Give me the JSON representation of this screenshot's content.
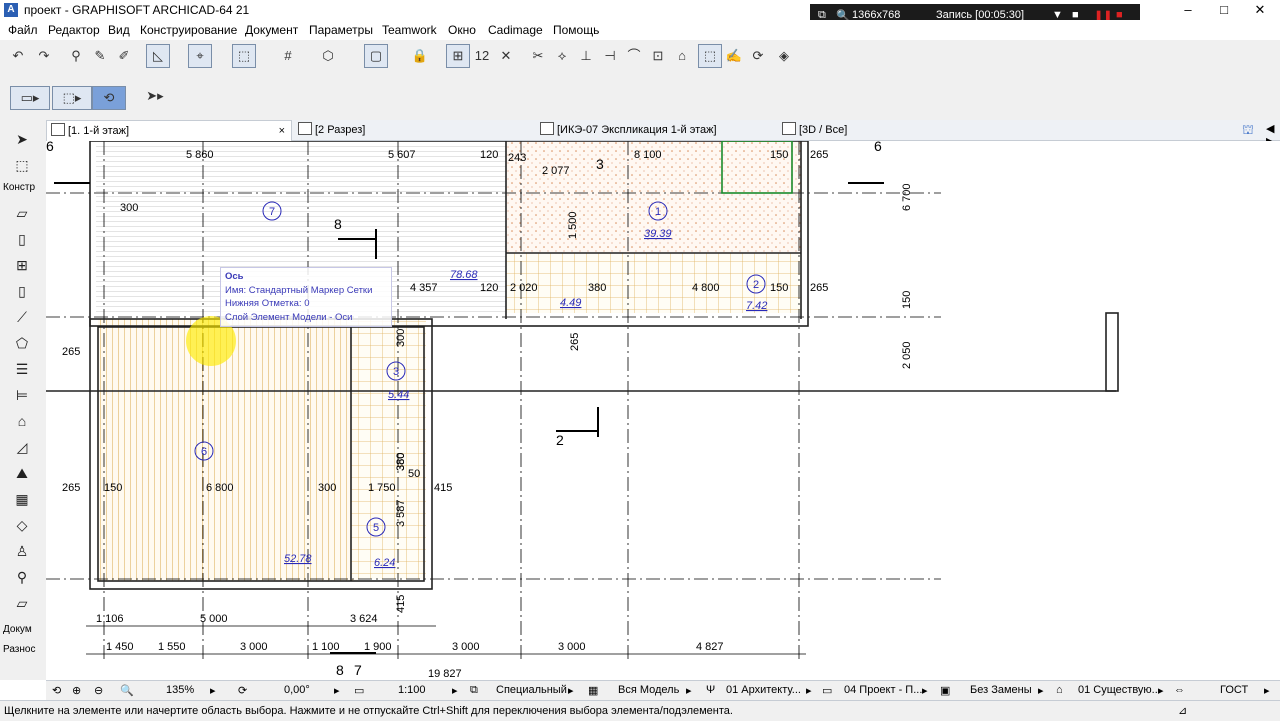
{
  "window": {
    "title": "проект - GRAPHISOFT ARCHICAD-64 21",
    "minimize": "–",
    "maximize": "□",
    "close": "✕"
  },
  "recorder": {
    "resolution": "1366x768",
    "status": "Запись [00:05:30]"
  },
  "menu": [
    "Файл",
    "Редактор",
    "Вид",
    "Конструирование",
    "Документ",
    "Параметры",
    "Teamwork",
    "Окно",
    "Cadimage",
    "Помощь"
  ],
  "tabs": [
    {
      "label": "[1. 1-й этаж]",
      "close": "×"
    },
    {
      "label": "[2 Разрез]"
    },
    {
      "label": "[ИКЭ-07 Экспликация 1-й этаж]"
    },
    {
      "label": "[3D / Все]"
    }
  ],
  "toolbox": {
    "group1": "Констр",
    "group2": "Докум",
    "group3": "Разнос"
  },
  "tooltip": {
    "heading": "Ось",
    "line1": "Имя: Стандартный Маркер Сетки",
    "line2": "Нижняя Отметка: 0",
    "line3": "Слой Элемент Модели - Оси"
  },
  "plan": {
    "dims_top": [
      "5 860",
      "5 607",
      "120",
      "243",
      "2 077",
      "8 100",
      "150",
      "265"
    ],
    "dims_mid": [
      "300",
      "4 357",
      "120",
      "2 020",
      "380",
      "4 800",
      "150",
      "265"
    ],
    "dims_left": [
      "265",
      "265",
      "150",
      "6 800",
      "300",
      "1 750",
      "415",
      "50",
      "380",
      "3 587"
    ],
    "dims_vert": [
      "6 700",
      "150",
      "2 050",
      "1 500",
      "380",
      "300",
      "265",
      "415"
    ],
    "dims_bottom1": [
      "1 106",
      "5 000",
      "3 624"
    ],
    "dims_bottom2": [
      "1 450",
      "1 550",
      "3 000",
      "1 100",
      "1 900",
      "3 000",
      "3 000",
      "4 827"
    ],
    "total": "19 827",
    "areas": [
      "78.68",
      "39.39",
      "4.49",
      "7.42",
      "5.44",
      "52.78",
      "6.24"
    ],
    "rooms": [
      "7",
      "1",
      "2",
      "6",
      "5",
      "3"
    ],
    "sections": [
      "6",
      "6",
      "8",
      "8",
      "2",
      "3",
      "7"
    ]
  },
  "status": {
    "zoom": "135%",
    "angle": "0,00°",
    "scale": "1:100",
    "layer_combo": "Специальный",
    "model_view": "Вся Модель",
    "pen_set": "01 Архитекту...",
    "mvo": "04 Проект - П...",
    "override": "Без Замены",
    "renovation": "01 Существую...",
    "standard": "ГОСТ"
  },
  "message": "Щелкните на элементе или начертите область выбора. Нажмите и не отпускайте Ctrl+Shift для переключения выбора элемента/подэлемента.",
  "colors": {
    "area_blue": "#2a2ab8",
    "hatch": "#d9a84a",
    "grid": "#000000",
    "tile": "#e7c27a"
  }
}
